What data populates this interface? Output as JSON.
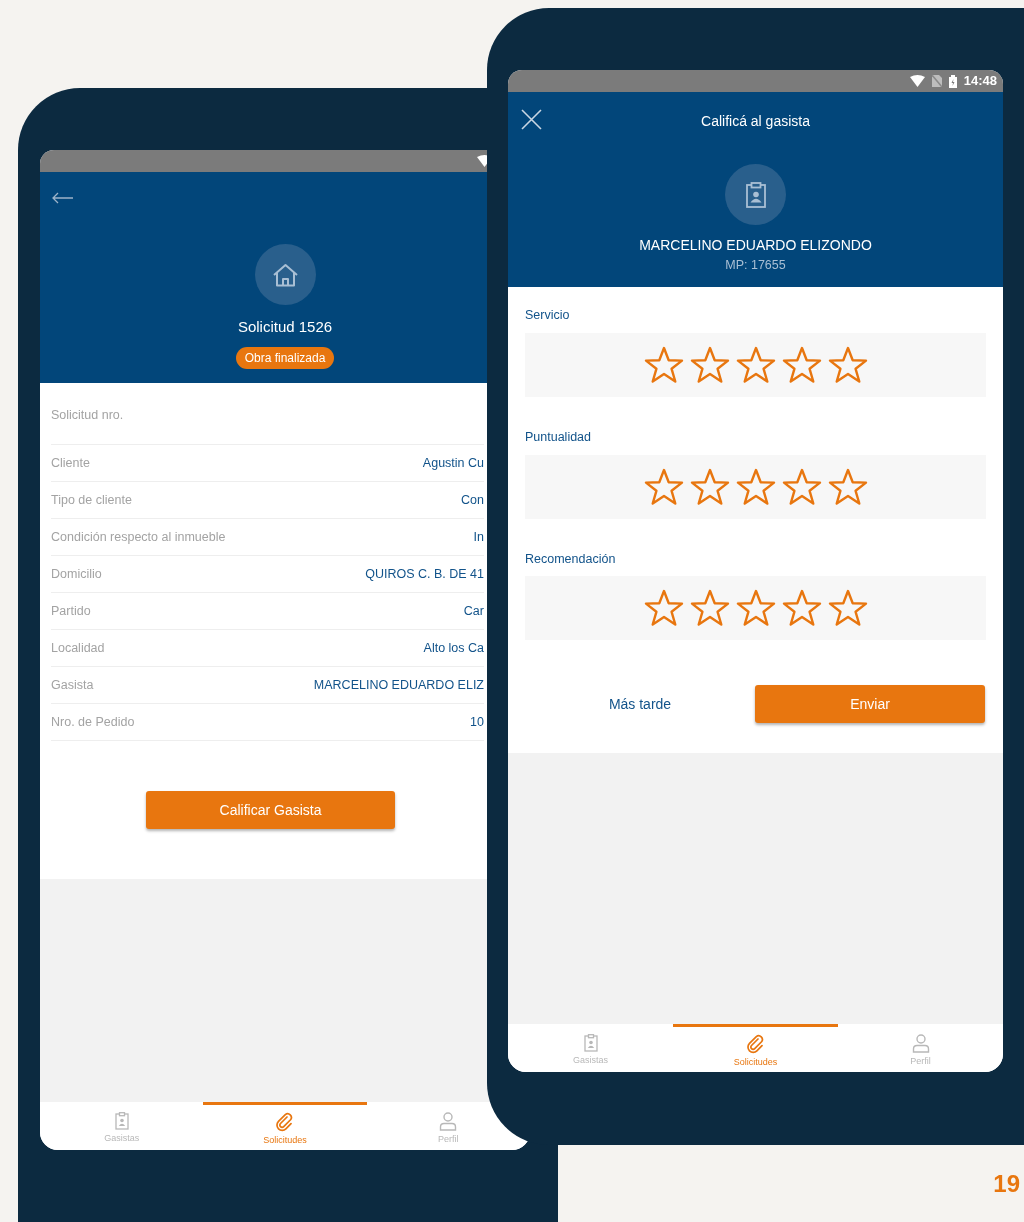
{
  "phones": [
    {
      "kind": "request_detail",
      "header": {
        "title": "Solicitud 1526",
        "badge": "Obra finalizada"
      },
      "details": [
        {
          "label": "Solicitud nro."
        },
        {
          "label": "Cliente",
          "value": "Agustin Cu"
        },
        {
          "label": "Tipo de cliente",
          "value": "Con"
        },
        {
          "label": "Condición respecto al inmueble",
          "value": "In"
        },
        {
          "label": "Domicilio",
          "value": "QUIROS C. B. DE 41"
        },
        {
          "label": "Partido",
          "value": "Car"
        },
        {
          "label": "Localidad",
          "value": "Alto los Ca"
        },
        {
          "label": "Gasista",
          "value": "MARCELINO EDUARDO ELIZ"
        },
        {
          "label": "Nro. de Pedido",
          "value": "10"
        }
      ],
      "primary_button": "Calificar Gasista",
      "bottom_nav": [
        {
          "label": "Gasistas",
          "selected": false
        },
        {
          "label": "Solicitudes",
          "selected": true
        },
        {
          "label": "Perfil",
          "selected": false
        }
      ]
    },
    {
      "kind": "rating",
      "status_bar": {
        "time": "14:48"
      },
      "header": {
        "title": "Calificá al gasista",
        "name": "MARCELINO EDUARDO ELIZONDO",
        "subtitle": "MP: 17655"
      },
      "ratings": [
        {
          "label": "Servicio",
          "stars": 0
        },
        {
          "label": "Puntualidad",
          "stars": 0
        },
        {
          "label": "Recomendación",
          "stars": 0
        }
      ],
      "secondary_button": "Más tarde",
      "primary_button": "Enviar",
      "bottom_nav": [
        {
          "label": "Gasistas",
          "selected": false
        },
        {
          "label": "Solicitudes",
          "selected": true
        },
        {
          "label": "Perfil",
          "selected": false
        }
      ]
    }
  ],
  "page_number": "19"
}
